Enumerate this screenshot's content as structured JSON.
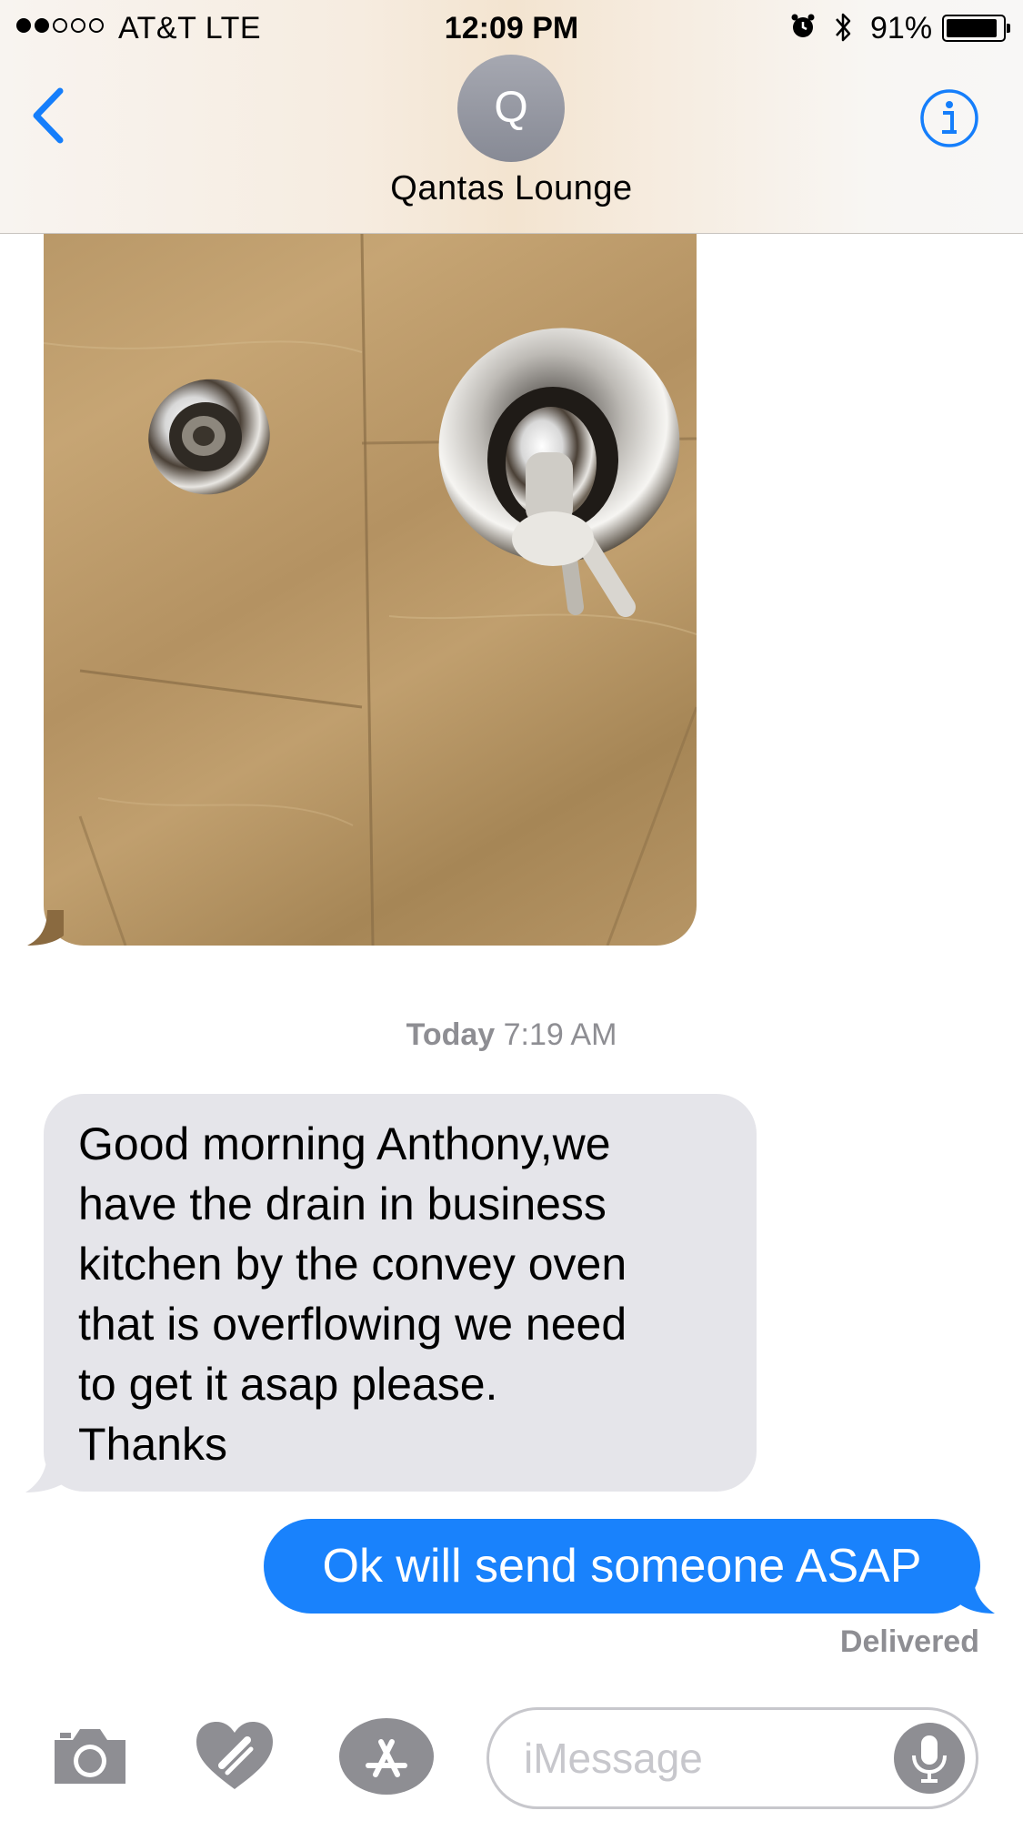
{
  "status_bar": {
    "carrier": "AT&T   LTE",
    "time": "12:09 PM",
    "battery_text": "91%",
    "battery_level": 0.91,
    "signal_bars_filled": 2,
    "signal_bars_total": 5
  },
  "header": {
    "avatar_initial": "Q",
    "contact_name": "Qantas Lounge",
    "back_icon": "chevron-left-icon",
    "info_icon": "info-icon"
  },
  "conversation": {
    "timestamp_day": "Today",
    "timestamp_time": " 7:19 AM",
    "received_lines": [
      "Good morning Anthony,we",
      "have the drain in business",
      "kitchen by the convey oven",
      "that is overflowing we need",
      "to get it asap please.",
      "Thanks"
    ],
    "sent_text": "Ok will send someone ASAP",
    "delivered_label": "Delivered"
  },
  "input_bar": {
    "placeholder": "iMessage",
    "camera_icon": "camera-icon",
    "digital_touch_icon": "heart-icon",
    "apps_icon": "app-store-icon",
    "mic_icon": "microphone-icon"
  },
  "colors": {
    "ios_blue": "#1982fc",
    "received_bubble": "#e5e5ea",
    "secondary_text": "#8e8e93",
    "photo_tone": "#b99868"
  }
}
